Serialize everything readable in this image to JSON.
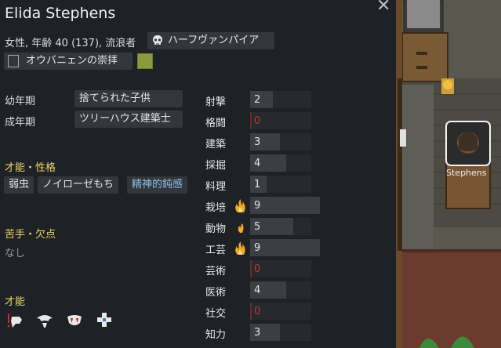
{
  "pawn": {
    "name": "Elida Stephens",
    "description": "女性, 年齢 40 (137), 流浪者",
    "xenotype": "ハーフヴァンパイア",
    "ideology": "オウバニェンの崇拝",
    "ideology_color": "#8b9a3d"
  },
  "backstory": {
    "childhood_label": "幼年期",
    "childhood": "捨てられた子供",
    "adulthood_label": "成年期",
    "adulthood": "ツリーハウス建築士"
  },
  "traits": {
    "title": "才能・性格",
    "items": [
      "弱虫",
      "ノイローゼもち",
      "精神的鈍感"
    ]
  },
  "incapable": {
    "title": "苦手・欠点",
    "value": "なし"
  },
  "abilities": {
    "title": "才能",
    "icons": [
      "bloodfeed-icon",
      "wings-icon",
      "fangs-icon",
      "coagulate-icon"
    ]
  },
  "skills": [
    {
      "name": "射撃",
      "level": 2,
      "passion": "none"
    },
    {
      "name": "格闘",
      "level": 0,
      "passion": "none"
    },
    {
      "name": "建築",
      "level": 3,
      "passion": "none"
    },
    {
      "name": "採掘",
      "level": 4,
      "passion": "none"
    },
    {
      "name": "料理",
      "level": 1,
      "passion": "none"
    },
    {
      "name": "栽培",
      "level": 9,
      "passion": "major"
    },
    {
      "name": "動物",
      "level": 5,
      "passion": "minor"
    },
    {
      "name": "工芸",
      "level": 9,
      "passion": "major"
    },
    {
      "name": "芸術",
      "level": 0,
      "passion": "none"
    },
    {
      "name": "医術",
      "level": 4,
      "passion": "none"
    },
    {
      "name": "社交",
      "level": 0,
      "passion": "none"
    },
    {
      "name": "知力",
      "level": 3,
      "passion": "none"
    }
  ],
  "world": {
    "pawn_label": "Stephens"
  }
}
